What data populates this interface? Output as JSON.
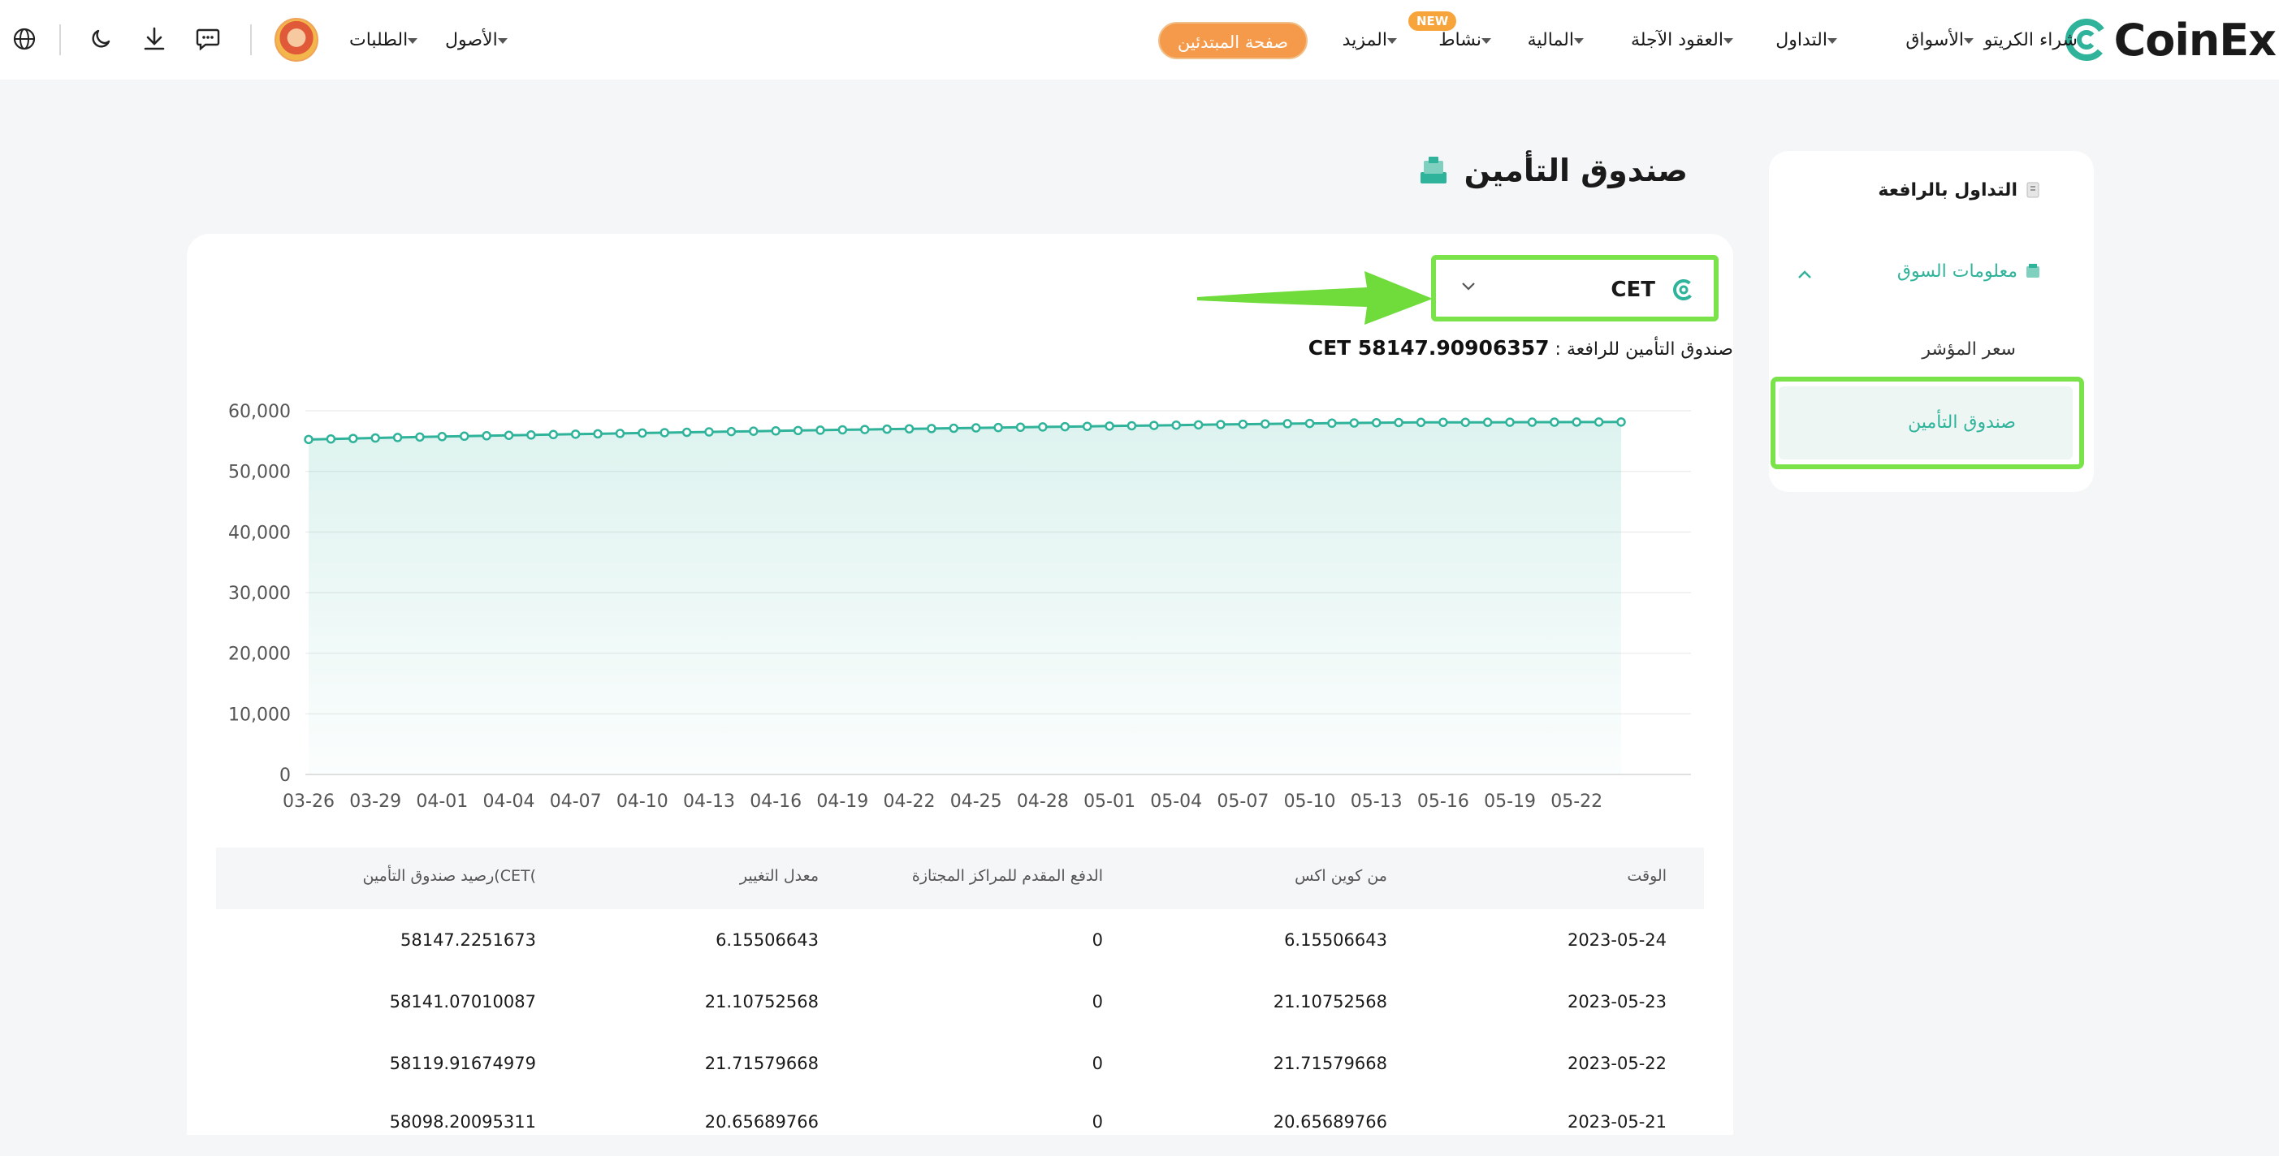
{
  "nav": {
    "brand": "CoinEx",
    "items": [
      "شراء الكريتو",
      "الأسواق",
      "التداول",
      "العقود الآجلة",
      "المالية",
      "نشاط",
      "المزيد"
    ],
    "new_badge": "NEW",
    "beginner": "صفحة المبتدئين",
    "assets": "الأصول",
    "orders": "الطلبات"
  },
  "sidebar": {
    "margin_trading": "التداول بالرافعة",
    "market_info": "معلومات السوق",
    "index_price": "سعر المؤشر",
    "insurance_fund": "صندوق التأمين"
  },
  "page": {
    "title": "صندوق التأمين",
    "selector": "CET",
    "fund_label": "صندوق التأمين للرافعة  :",
    "fund_value": "CET 58147.90906357"
  },
  "colors": {
    "accent": "#2fb39a",
    "highlight": "#7be34a",
    "orange": "#f49a4a"
  },
  "chart_data": {
    "type": "area",
    "x_ticks": [
      "03-26",
      "03-29",
      "04-01",
      "04-04",
      "04-07",
      "04-10",
      "04-13",
      "04-16",
      "04-19",
      "04-22",
      "04-25",
      "04-28",
      "05-01",
      "05-04",
      "05-07",
      "05-10",
      "05-13",
      "05-16",
      "05-19",
      "05-22"
    ],
    "y_ticks": [
      "0",
      "10,000",
      "20,000",
      "30,000",
      "40,000",
      "50,000",
      "60,000"
    ],
    "ylim": [
      0,
      60000
    ],
    "x_start": "2023-03-26",
    "x_end": "2023-05-24",
    "series": [
      {
        "values": [
          55264,
          55350,
          55430,
          55510,
          55590,
          55670,
          55740,
          55810,
          55880,
          55950,
          56010,
          56080,
          56140,
          56200,
          56260,
          56330,
          56390,
          56450,
          56510,
          56570,
          56630,
          56680,
          56740,
          56800,
          56860,
          56910,
          56970,
          57020,
          57070,
          57120,
          57180,
          57230,
          57280,
          57330,
          57380,
          57430,
          57480,
          57530,
          57580,
          57630,
          57680,
          57730,
          57780,
          57830,
          57870,
          57910,
          57950,
          57990,
          58030,
          58060,
          58090,
          58098,
          58098,
          58100,
          58110,
          58119,
          58125,
          58141,
          58145,
          58147
        ]
      }
    ]
  },
  "table": {
    "headers": [
      "الوقت",
      "من كوين اكس",
      "الدفع المقدم للمراكز المجتازة",
      "معدل التغيير",
      "رصيد صندوق التأمين(CET("
    ],
    "rows": [
      [
        "2023-05-24",
        "6.15506643",
        "0",
        "6.15506643",
        "58147.2251673"
      ],
      [
        "2023-05-23",
        "21.10752568",
        "0",
        "21.10752568",
        "58141.07010087"
      ],
      [
        "2023-05-22",
        "21.71579668",
        "0",
        "21.71579668",
        "58119.91674979"
      ],
      [
        "2023-05-21",
        "20.65689766",
        "0",
        "20.65689766",
        "58098.20095311"
      ]
    ]
  }
}
